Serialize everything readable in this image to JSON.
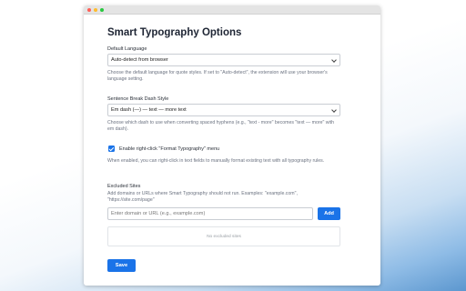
{
  "window": {
    "traffic_lights": [
      "#ff5f57",
      "#febc2e",
      "#28c840"
    ]
  },
  "page": {
    "title": "Smart Typography Options"
  },
  "default_language": {
    "label": "Default Language",
    "selected": "Auto-detect from browser",
    "description": "Choose the default language for quote styles. If set to \"Auto-detect\", the extension will use your browser's language setting."
  },
  "dash_style": {
    "label": "Sentence Break Dash Style",
    "selected": "Em dash (—) — text — more text",
    "description": "Choose which dash to use when converting spaced hyphens (e.g., \"text - more\" becomes \"text — more\" with em dash)."
  },
  "context_menu": {
    "checked": true,
    "label": "Enable right-click \"Format Typography\" menu",
    "description": "When enabled, you can right-click in text fields to manually format existing text with all typography rules."
  },
  "excluded_sites": {
    "label": "Excluded Sites",
    "description": "Add domains or URLs where Smart Typography should not run. Examples: \"example.com\", \"https://site.com/page\"",
    "input_placeholder": "Enter domain or URL (e.g., example.com)",
    "add_label": "Add",
    "empty_text": "No excluded sites"
  },
  "save_label": "Save",
  "colors": {
    "accent": "#1a73e8"
  }
}
